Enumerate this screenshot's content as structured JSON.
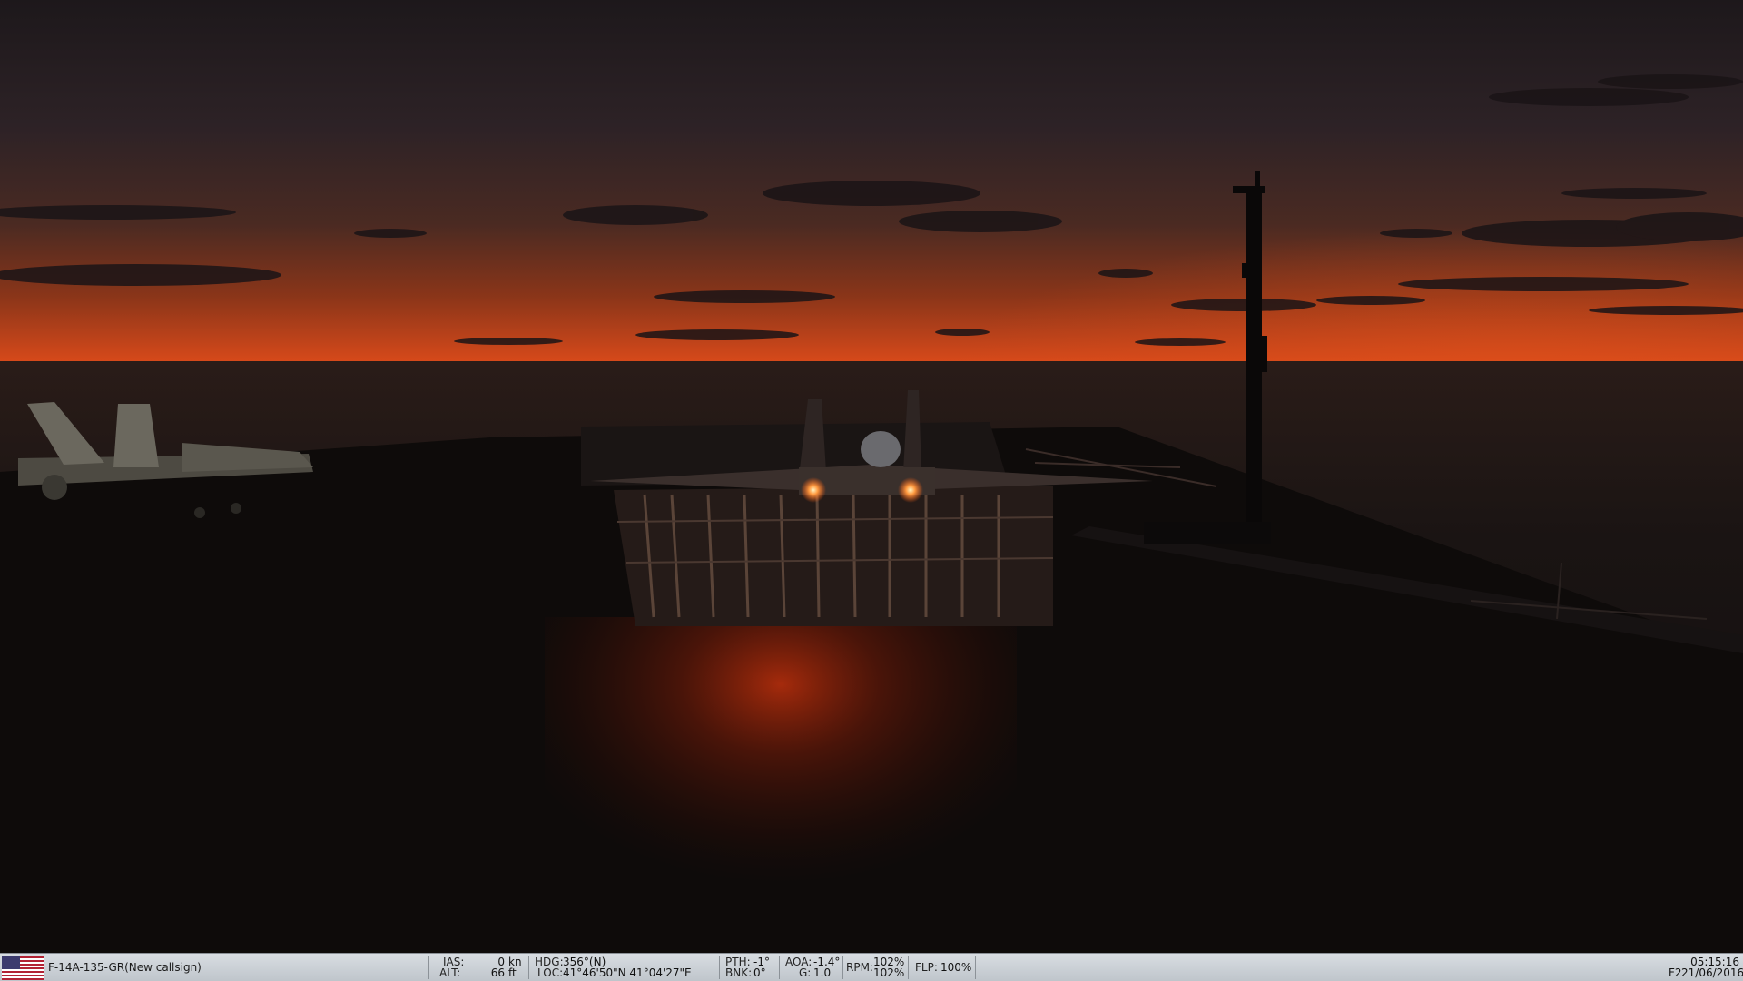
{
  "status_bar": {
    "flag_icon": "us-flag-icon",
    "unit_name": "F-14A-135-GR(New callsign)",
    "ias_label": "IAS:",
    "ias_value": "0",
    "ias_unit": "kn",
    "alt_label": "ALT:",
    "alt_value": "66",
    "alt_unit": "ft",
    "hdg_label": "HDG:",
    "hdg_value": "356°(N)",
    "loc_label": "LOC:",
    "loc_value": "41°46'50\"N 41°04'27\"E",
    "pth_label": "PTH:",
    "pth_value": "-1°",
    "bnk_label": "BNK:",
    "bnk_value": "0°",
    "aoa_label": "AOA:",
    "aoa_value": "-1.4°",
    "g_label": "G:",
    "g_value": "1.0",
    "rpm_label": "RPM:",
    "rpm_value_1": "102%",
    "rpm_value_2": "102%",
    "flp_label": "FLP:",
    "flp_value": "100%",
    "time": "05:15:16",
    "view_key": "F2",
    "date": "21/06/2016"
  },
  "colors": {
    "sky_top": "#231c1f",
    "sky_horizon": "#d0451a",
    "sea": "#171314",
    "deck": "#100d0c",
    "afterburner_glow": "#ff7a30",
    "status_bar_bg": "#cfd4d9"
  }
}
